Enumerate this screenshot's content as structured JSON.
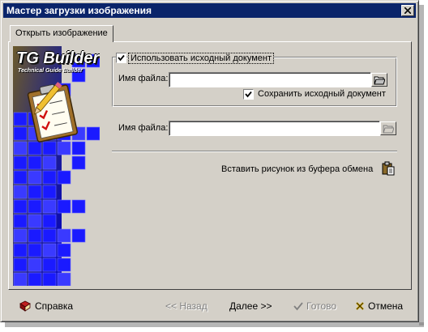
{
  "window": {
    "title": "Мастер загрузки изображения"
  },
  "tab": {
    "label": "Открыть изображение"
  },
  "logo": {
    "title": "TG Builder",
    "subtitle": "Technical Guide Builder"
  },
  "source_group": {
    "use_original_label": "Использовать исходный документ",
    "use_original_checked": true,
    "filename_label": "Имя файла:",
    "filename_value": "",
    "save_original_label": "Сохранить исходный документ",
    "save_original_checked": true
  },
  "target": {
    "filename_label": "Имя файла:",
    "filename_value": ""
  },
  "paste": {
    "label": "Вставить рисунок из буфера обмена"
  },
  "buttons": {
    "help": "Справка",
    "back": "<< Назад",
    "next": "Далее >>",
    "finish": "Готово",
    "cancel": "Отмена"
  },
  "colors": {
    "titlebar": "#0a246a",
    "face": "#d4d0c8",
    "tile_blue": "#1a1aff"
  }
}
